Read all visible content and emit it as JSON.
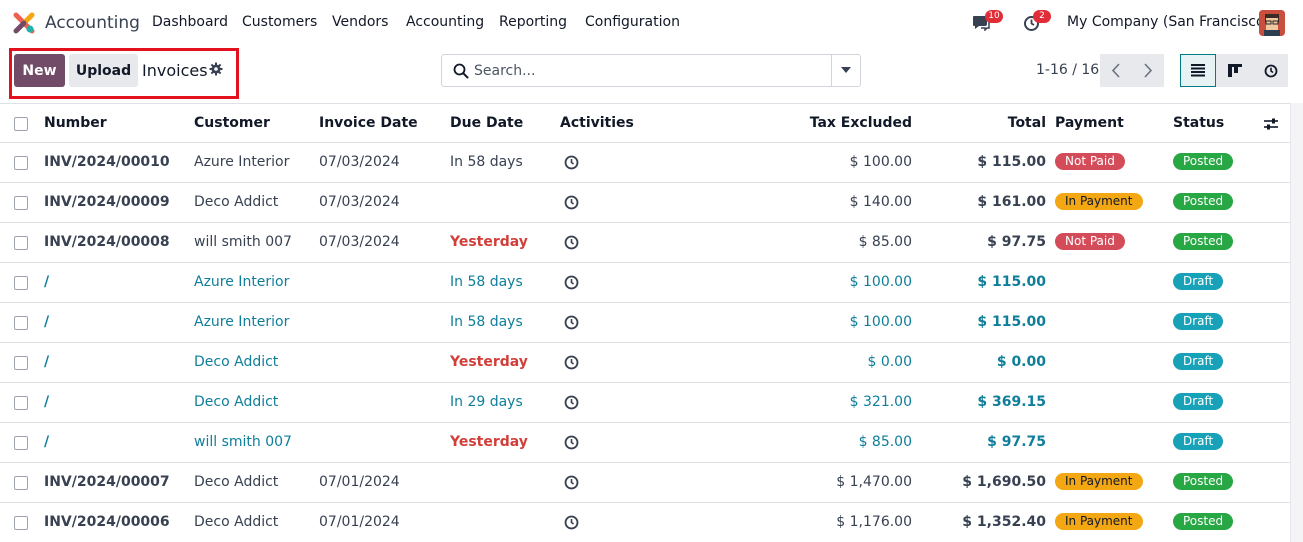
{
  "navbar": {
    "app_name": "Accounting",
    "menu": [
      "Dashboard",
      "Customers",
      "Vendors",
      "Accounting",
      "Reporting",
      "Configuration"
    ],
    "messages_count": "10",
    "activities_count": "2",
    "company": "My Company (San Francisco)",
    "brand_color": "#714b67"
  },
  "control_panel": {
    "new_label": "New",
    "upload_label": "Upload",
    "title": "Invoices",
    "search_placeholder": "Search...",
    "pager": "1-16 / 16",
    "active_view": "list"
  },
  "table": {
    "columns": {
      "number": "Number",
      "customer": "Customer",
      "invoice_date": "Invoice Date",
      "due_date": "Due Date",
      "activities": "Activities",
      "tax_excluded": "Tax Excluded",
      "total": "Total",
      "payment": "Payment",
      "status": "Status"
    },
    "rows": [
      {
        "number": "INV/2024/00010",
        "customer": "Azure Interior",
        "invoice_date": "07/03/2024",
        "due_date": "In 58 days",
        "due_overdue": false,
        "tax_excluded": "$ 100.00",
        "total": "$ 115.00",
        "payment": "Not Paid",
        "status": "Posted",
        "draft": false
      },
      {
        "number": "INV/2024/00009",
        "customer": "Deco Addict",
        "invoice_date": "07/03/2024",
        "due_date": "",
        "due_overdue": false,
        "tax_excluded": "$ 140.00",
        "total": "$ 161.00",
        "payment": "In Payment",
        "status": "Posted",
        "draft": false
      },
      {
        "number": "INV/2024/00008",
        "customer": "will smith 007",
        "invoice_date": "07/03/2024",
        "due_date": "Yesterday",
        "due_overdue": true,
        "tax_excluded": "$ 85.00",
        "total": "$ 97.75",
        "payment": "Not Paid",
        "status": "Posted",
        "draft": false
      },
      {
        "number": "/",
        "customer": "Azure Interior",
        "invoice_date": "",
        "due_date": "In 58 days",
        "due_overdue": false,
        "tax_excluded": "$ 100.00",
        "total": "$ 115.00",
        "payment": "",
        "status": "Draft",
        "draft": true
      },
      {
        "number": "/",
        "customer": "Azure Interior",
        "invoice_date": "",
        "due_date": "In 58 days",
        "due_overdue": false,
        "tax_excluded": "$ 100.00",
        "total": "$ 115.00",
        "payment": "",
        "status": "Draft",
        "draft": true
      },
      {
        "number": "/",
        "customer": "Deco Addict",
        "invoice_date": "",
        "due_date": "Yesterday",
        "due_overdue": true,
        "tax_excluded": "$ 0.00",
        "total": "$ 0.00",
        "payment": "",
        "status": "Draft",
        "draft": true
      },
      {
        "number": "/",
        "customer": "Deco Addict",
        "invoice_date": "",
        "due_date": "In 29 days",
        "due_overdue": false,
        "tax_excluded": "$ 321.00",
        "total": "$ 369.15",
        "payment": "",
        "status": "Draft",
        "draft": true
      },
      {
        "number": "/",
        "customer": "will smith 007",
        "invoice_date": "",
        "due_date": "Yesterday",
        "due_overdue": true,
        "tax_excluded": "$ 85.00",
        "total": "$ 97.75",
        "payment": "",
        "status": "Draft",
        "draft": true
      },
      {
        "number": "INV/2024/00007",
        "customer": "Deco Addict",
        "invoice_date": "07/01/2024",
        "due_date": "",
        "due_overdue": false,
        "tax_excluded": "$ 1,470.00",
        "total": "$ 1,690.50",
        "payment": "In Payment",
        "status": "Posted",
        "draft": false
      },
      {
        "number": "INV/2024/00006",
        "customer": "Deco Addict",
        "invoice_date": "07/01/2024",
        "due_date": "",
        "due_overdue": false,
        "tax_excluded": "$ 1,176.00",
        "total": "$ 1,352.40",
        "payment": "In Payment",
        "status": "Posted",
        "draft": false
      }
    ]
  }
}
